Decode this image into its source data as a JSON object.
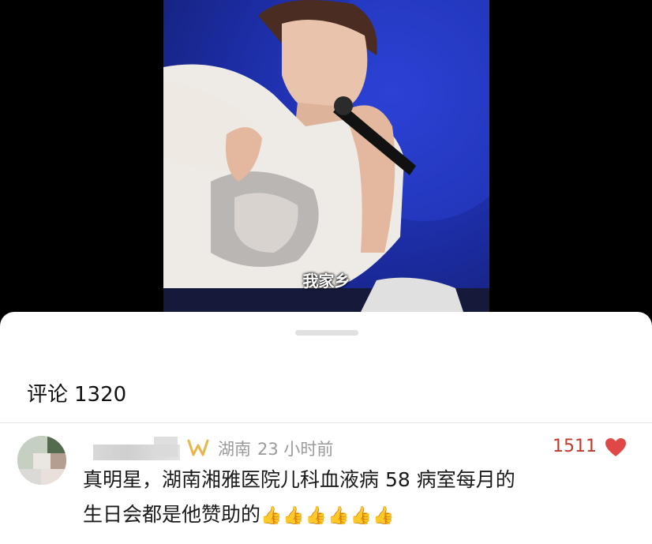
{
  "video": {
    "subtitle": "我家乡"
  },
  "comments_panel": {
    "title_label": "评论",
    "count": "1320"
  },
  "comment": {
    "region": "湖南",
    "time": "23 小时前",
    "likes": "1511",
    "text_line1": "真明星，湖南湘雅医院儿科血液病 58 病室每月的",
    "text_line2": "生日会都是他赞助的",
    "reactions": "👍👍👍👍👍👍",
    "badge_icon": "w-badge-icon",
    "like_icon": "heart-icon"
  },
  "colors": {
    "accent_red": "#e04848",
    "badge_gold": "#e8b64a",
    "meta_gray": "#9a9a9a"
  }
}
